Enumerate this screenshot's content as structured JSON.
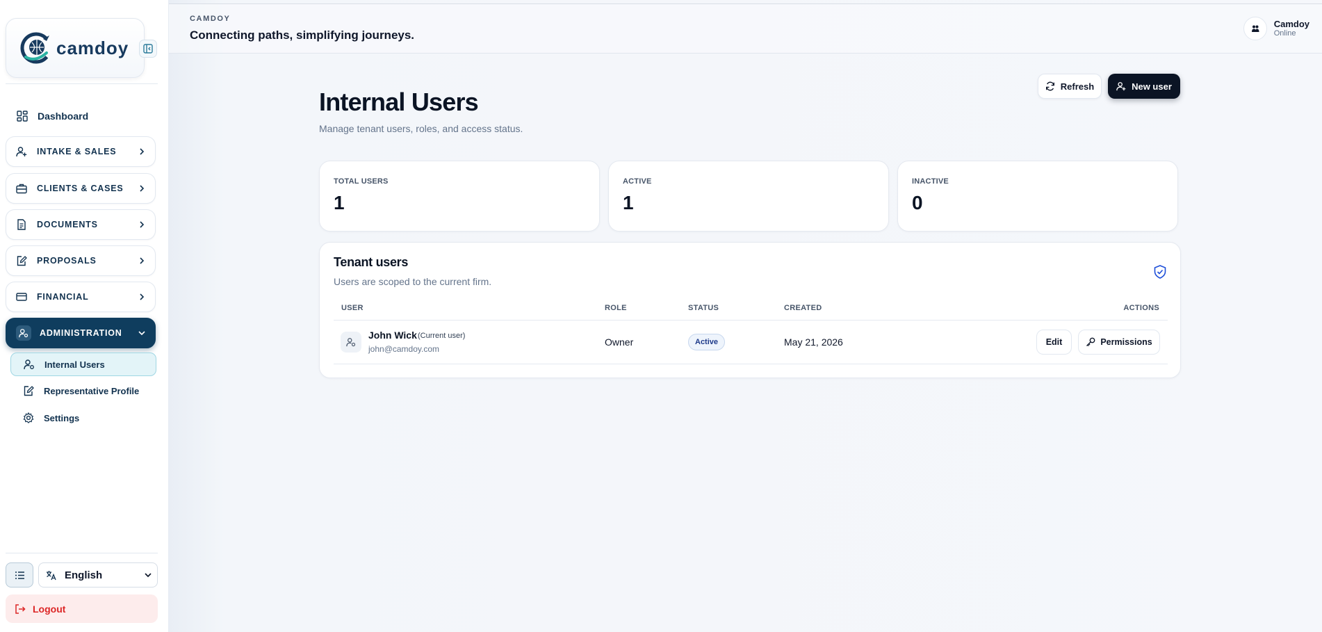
{
  "sidebar": {
    "logo_text": "camdoy",
    "dashboard": "Dashboard",
    "groups": [
      {
        "label": "INTAKE & SALES",
        "icon": "user-plus-icon"
      },
      {
        "label": "CLIENTS & CASES",
        "icon": "briefcase-icon"
      },
      {
        "label": "DOCUMENTS",
        "icon": "document-icon"
      },
      {
        "label": "PROPOSALS",
        "icon": "edit-document-icon"
      },
      {
        "label": "FINANCIAL",
        "icon": "credit-card-icon"
      },
      {
        "label": "ADMINISTRATION",
        "icon": "user-cog-icon",
        "expanded": true
      }
    ],
    "sub_items": [
      {
        "label": "Internal Users",
        "icon": "user-cog-icon",
        "active": true
      },
      {
        "label": "Representative Profile",
        "icon": "edit-document-icon"
      },
      {
        "label": "Settings",
        "icon": "gear-icon"
      }
    ],
    "language": "English",
    "logout": "Logout"
  },
  "header": {
    "brand": "CAMDOY",
    "tagline": "Connecting paths, simplifying journeys.",
    "user_name": "Camdoy",
    "user_status": "Online"
  },
  "page": {
    "title": "Internal Users",
    "subtitle": "Manage tenant users, roles, and access status.",
    "refresh_label": "Refresh",
    "new_user_label": "New user"
  },
  "stats": [
    {
      "label": "TOTAL USERS",
      "value": "1"
    },
    {
      "label": "ACTIVE",
      "value": "1"
    },
    {
      "label": "INACTIVE",
      "value": "0"
    }
  ],
  "table": {
    "title": "Tenant users",
    "subtitle": "Users are scoped to the current firm.",
    "columns": [
      "USER",
      "ROLE",
      "STATUS",
      "CREATED",
      "ACTIONS"
    ],
    "rows": [
      {
        "name": "John Wick",
        "tag": "(Current user)",
        "email": "john@camdoy.com",
        "role": "Owner",
        "status": "Active",
        "created": "May 21, 2026",
        "edit_label": "Edit",
        "permissions_label": "Permissions"
      }
    ]
  },
  "colors": {
    "brand_navy": "#0f3d5e",
    "logo_teal": "#2bb3a3",
    "logout_red": "#dc2626",
    "primary_button": "#0b1424",
    "status_blue": "#1e3a8a"
  }
}
